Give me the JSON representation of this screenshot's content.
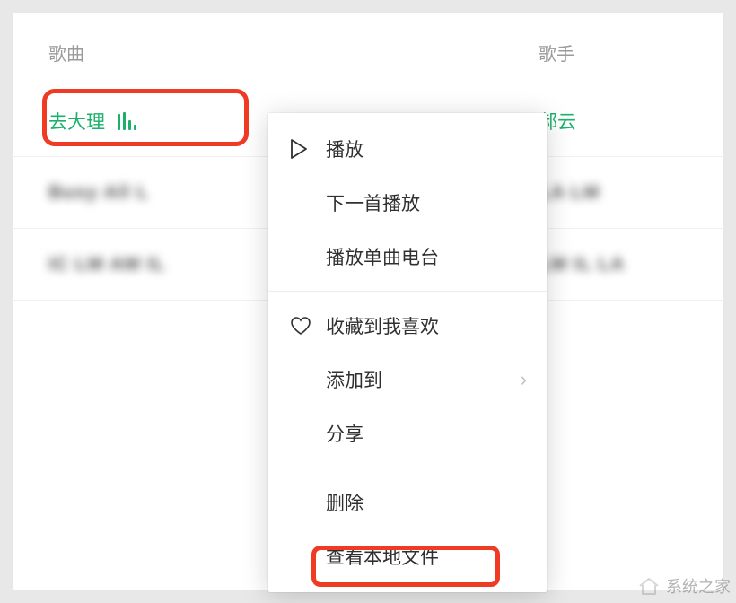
{
  "headers": {
    "song": "歌曲",
    "artist": "歌手"
  },
  "rows": [
    {
      "song": "去大理",
      "artist": "郝云",
      "active": true
    },
    {
      "song": "Busy All L",
      "artist": "LA LM",
      "active": false
    },
    {
      "song": "IC LM AM IL",
      "artist": "LM IL LA",
      "active": false
    }
  ],
  "menu": {
    "groups": [
      [
        {
          "icon": "play",
          "label": "播放"
        },
        {
          "icon": "",
          "label": "下一首播放"
        },
        {
          "icon": "",
          "label": "播放单曲电台"
        }
      ],
      [
        {
          "icon": "heart",
          "label": "收藏到我喜欢"
        },
        {
          "icon": "",
          "label": "添加到",
          "submenu": true
        },
        {
          "icon": "",
          "label": "分享"
        }
      ],
      [
        {
          "icon": "",
          "label": "删除"
        },
        {
          "icon": "",
          "label": "查看本地文件",
          "highlight": true
        }
      ]
    ]
  },
  "watermark": "系统之家"
}
